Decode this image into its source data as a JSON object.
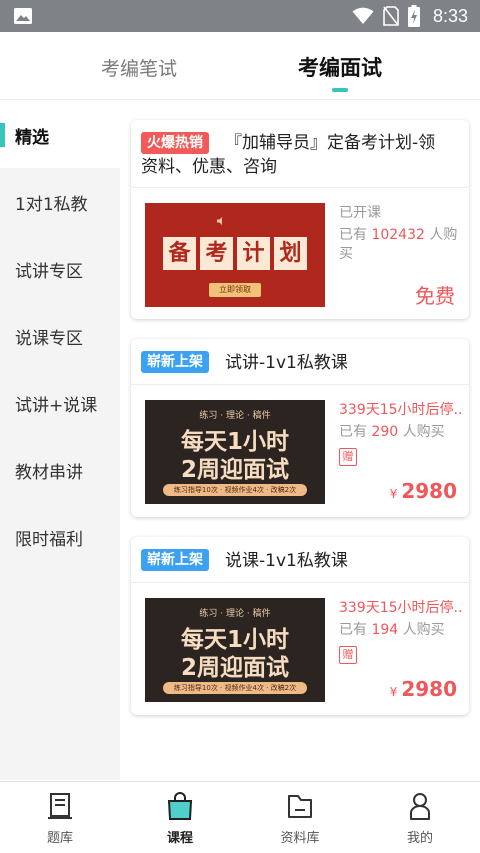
{
  "status_bar": {
    "time": "8:33"
  },
  "top_tabs": [
    {
      "label": "考编笔试",
      "active": false
    },
    {
      "label": "考编面试",
      "active": true
    }
  ],
  "side_menu": [
    {
      "label": "精选",
      "active": true
    },
    {
      "label": "1对1私教",
      "active": false
    },
    {
      "label": "试讲专区",
      "active": false
    },
    {
      "label": "说课专区",
      "active": false
    },
    {
      "label": "试讲+说课",
      "active": false
    },
    {
      "label": "教材串讲",
      "active": false
    },
    {
      "label": "限时福利",
      "active": false
    }
  ],
  "courses": [
    {
      "badge": "火爆热销",
      "title_line1": "『加辅导员』定备考计划-领",
      "title_line2": "资料、优惠、咨询",
      "thumb": {
        "chars": [
          "备",
          "考",
          "计",
          "划"
        ],
        "button": "立即领取"
      },
      "status": "已开课",
      "bought_prefix": "已有",
      "bought_count": "102432",
      "bought_suffix1": "人购",
      "bought_suffix2": "买",
      "price": "免费"
    },
    {
      "badge": "崭新上架",
      "title": "试讲-1v1私教课",
      "thumb": {
        "top": "练习 · 理论 · 稿件",
        "line1": "每天1小时",
        "line2": "2周迎面试",
        "bar": "练习指导10次 · 视频作业4次 · 改稿2次"
      },
      "countdown": "339天15小时后停...",
      "bought_prefix": "已有",
      "bought_count": "290",
      "bought_suffix": "人购买",
      "gift": "赠",
      "currency": "¥",
      "price": "2980"
    },
    {
      "badge": "崭新上架",
      "title": "说课-1v1私教课",
      "thumb": {
        "top": "练习 · 理论 · 稿件",
        "line1": "每天1小时",
        "line2": "2周迎面试",
        "bar": "练习指导10次 · 视频作业4次 · 改稿2次"
      },
      "countdown": "339天15小时后停...",
      "bought_prefix": "已有",
      "bought_count": "194",
      "bought_suffix": "人购买",
      "gift": "赠",
      "currency": "¥",
      "price": "2980"
    }
  ],
  "bottom_nav": [
    {
      "label": "题库",
      "icon": "question-bank-icon",
      "active": false
    },
    {
      "label": "课程",
      "icon": "course-bag-icon",
      "active": true
    },
    {
      "label": "资料库",
      "icon": "folder-icon",
      "active": false
    },
    {
      "label": "我的",
      "icon": "profile-icon",
      "active": false
    }
  ],
  "colors": {
    "accent": "#36c5bd",
    "price_red": "#f0575a",
    "hot_badge": "#f25a5a",
    "new_badge": "#3ba1f0"
  }
}
